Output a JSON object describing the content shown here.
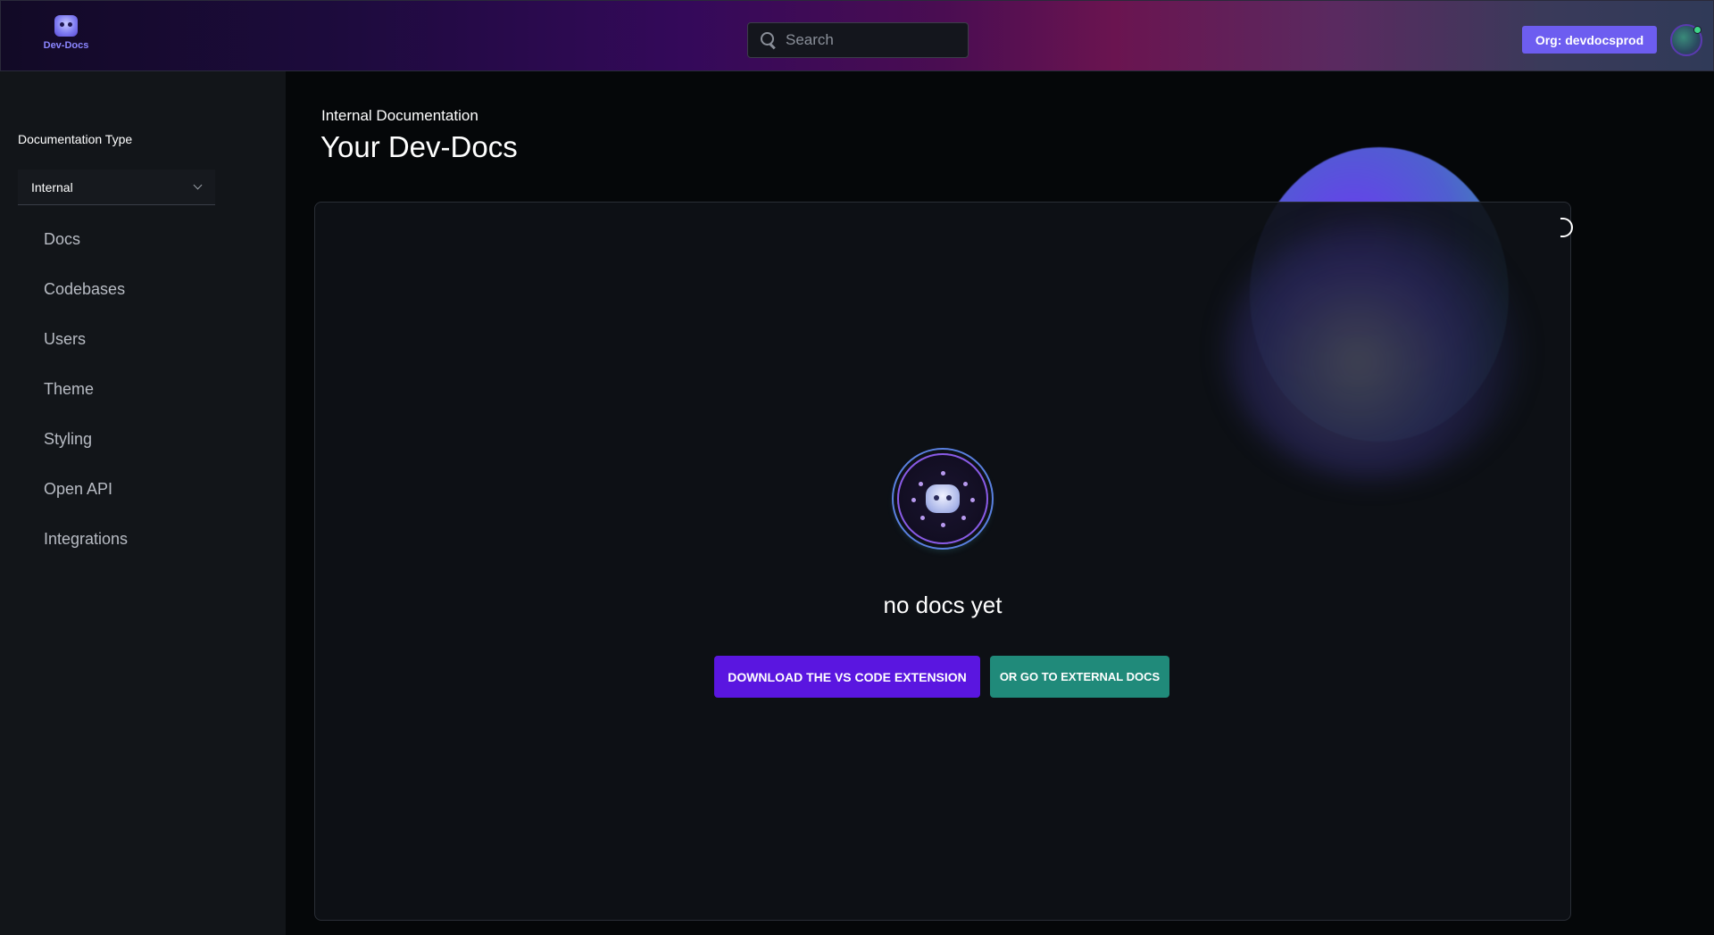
{
  "header": {
    "logo_text": "Dev-Docs",
    "search_placeholder": "Search",
    "org_button_label": "Org: devdocsprod"
  },
  "sidebar": {
    "doc_type_label": "Documentation Type",
    "doc_type_selected": "Internal",
    "items": [
      {
        "label": "Docs"
      },
      {
        "label": "Codebases"
      },
      {
        "label": "Users"
      },
      {
        "label": "Theme"
      },
      {
        "label": "Styling"
      },
      {
        "label": "Open API"
      },
      {
        "label": "Integrations"
      }
    ]
  },
  "main": {
    "subtitle": "Internal Documentation",
    "title": "Your Dev-Docs",
    "empty_state": {
      "message": "no docs yet",
      "primary_button": "DOWNLOAD THE VS CODE EXTENSION",
      "secondary_button": "OR GO TO EXTERNAL DOCS"
    }
  },
  "colors": {
    "accent_purple": "#5a16e0",
    "accent_teal": "#208a7a",
    "org_button": "#6d5df0"
  }
}
